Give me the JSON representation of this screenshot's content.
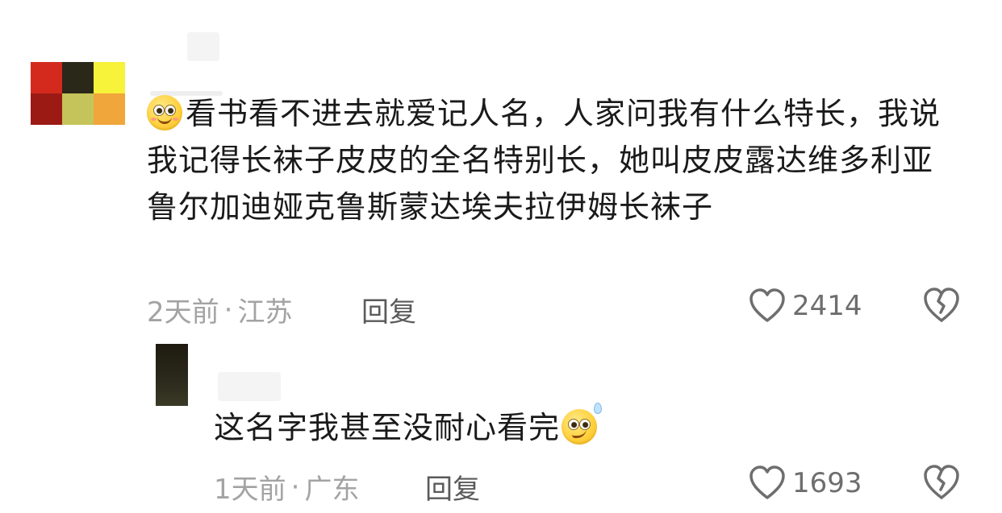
{
  "comment": {
    "avatar_colors": [
      "#d42a1e",
      "#2a2818",
      "#f7f23a",
      "#9c1a14",
      "#c4c45a",
      "#f0a63a"
    ],
    "text": "看书看不进去就爱记人名，人家问我有什么特长，我说我记得长袜子皮皮的全名特别长，她叫皮皮露达维多利亚鲁尔加迪娅克鲁斯蒙达埃夫拉伊姆长袜子",
    "time": "2天前",
    "separator": "·",
    "location": "江苏",
    "reply_label": "回复",
    "likes": "2414",
    "emoji_icon": "smiling-emoji-icon"
  },
  "reply": {
    "avatar_color": "#231f12",
    "text": "这名字我甚至没耐心看完",
    "time": "1天前",
    "separator": "·",
    "location": "广东",
    "reply_label": "回复",
    "likes": "1693",
    "emoji_icon": "sweat-smile-emoji-icon"
  },
  "icons": {
    "like": "heart-outline-icon",
    "dislike": "broken-heart-icon"
  }
}
